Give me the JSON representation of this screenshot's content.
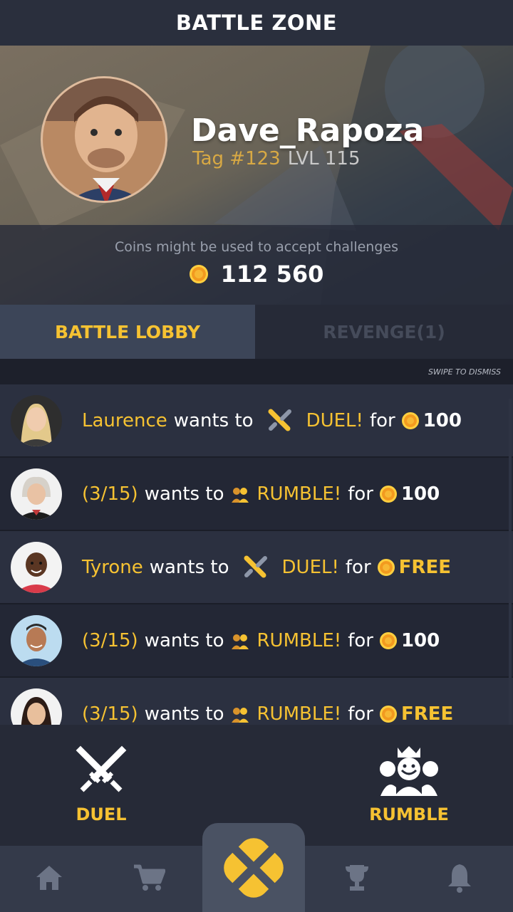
{
  "header": {
    "title": "BATTLE ZONE"
  },
  "profile": {
    "username": "Dave_Rapoza",
    "tag": "Tag #123",
    "level": "LVL 115",
    "coins_note": "Coins might be used to accept challenges",
    "coins": "112 560"
  },
  "tabs": [
    {
      "label": "BATTLE LOBBY",
      "active": true
    },
    {
      "label": "REVENGE(1)",
      "active": false
    }
  ],
  "swipe_hint": "SWIPE TO DISMISS",
  "challenges": [
    {
      "name": "Laurence",
      "wants": "wants to",
      "mode": "DUEL!",
      "mode_icon": "swords-icon",
      "for": "for",
      "stake": "100",
      "free": false
    },
    {
      "name": "(3/15)",
      "wants": "wants to",
      "mode": "RUMBLE!",
      "mode_icon": "group-icon",
      "for": "for",
      "stake": "100",
      "free": false
    },
    {
      "name": "Tyrone",
      "wants": "wants to",
      "mode": "DUEL!",
      "mode_icon": "swords-icon",
      "for": "for",
      "stake": "FREE",
      "free": true
    },
    {
      "name": "(3/15)",
      "wants": "wants to",
      "mode": "RUMBLE!",
      "mode_icon": "group-icon",
      "for": "for",
      "stake": "100",
      "free": false
    },
    {
      "name": "(3/15)",
      "wants": "wants to",
      "mode": "RUMBLE!",
      "mode_icon": "group-icon",
      "for": "for",
      "stake": "FREE",
      "free": true
    }
  ],
  "actions": {
    "duel_label": "DUEL",
    "rumble_label": "RUMBLE"
  },
  "nav": {
    "items": [
      "home-icon",
      "cart-icon",
      "battle-icon",
      "trophy-icon",
      "bell-icon"
    ],
    "accent": "#f6c232"
  }
}
